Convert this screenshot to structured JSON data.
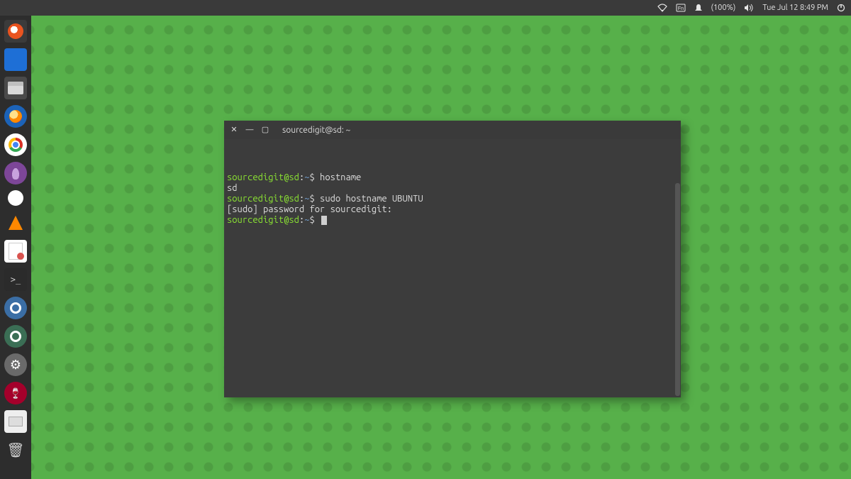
{
  "top_panel": {
    "battery": "(100%)",
    "datetime": "Tue Jul 12  8:49 PM"
  },
  "launcher": {
    "items": [
      {
        "name": "dash-icon"
      },
      {
        "name": "app-icon"
      },
      {
        "name": "files-icon"
      },
      {
        "name": "firefox-icon"
      },
      {
        "name": "chromium-icon"
      },
      {
        "name": "tor-icon"
      },
      {
        "name": "dot-icon"
      },
      {
        "name": "vlc-icon"
      },
      {
        "name": "gedit-icon"
      },
      {
        "name": "terminal-icon"
      },
      {
        "name": "disc-icon"
      },
      {
        "name": "disc2-icon"
      },
      {
        "name": "settings-icon"
      },
      {
        "name": "wine-icon"
      },
      {
        "name": "usb-icon"
      },
      {
        "name": "trash-icon"
      }
    ]
  },
  "terminal": {
    "title": "sourcedigit@sd: ~",
    "lines": [
      {
        "prompt_user": "sourcedigit@sd",
        "prompt_sep": ":",
        "prompt_path": "~",
        "prompt_end": "$ ",
        "cmd": "hostname"
      },
      {
        "output": "sd"
      },
      {
        "prompt_user": "sourcedigit@sd",
        "prompt_sep": ":",
        "prompt_path": "~",
        "prompt_end": "$ ",
        "cmd": "sudo hostname UBUNTU"
      },
      {
        "output": "[sudo] password for sourcedigit:"
      },
      {
        "prompt_user": "sourcedigit@sd",
        "prompt_sep": ":",
        "prompt_path": "~",
        "prompt_end": "$ ",
        "cmd": "",
        "cursor": true
      }
    ]
  }
}
